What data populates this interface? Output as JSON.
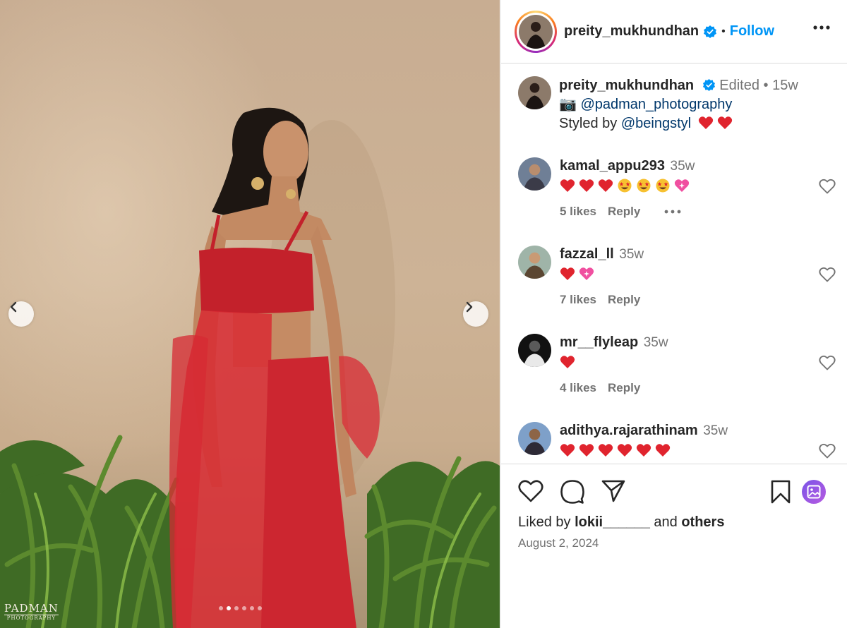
{
  "photo": {
    "watermark_top": "PADMAN",
    "watermark_sub": "PHOTOGRAPHY",
    "carousel_total": 6,
    "carousel_active_index": 1
  },
  "post_header": {
    "username": "preity_mukhundhan",
    "separator": "•",
    "follow_label": "Follow"
  },
  "caption": {
    "username": "preity_mukhundhan",
    "edited": "Edited",
    "separator": "•",
    "time": "15w",
    "camera_emoji": "📷",
    "photo_credit": "@padman_photography",
    "styled_prefix": "Styled by",
    "stylist": "@beingstyl",
    "hearts": "❤️ ❤️"
  },
  "comments": [
    {
      "username": "kamal_appu293",
      "time": "35w",
      "emojis": [
        "heart",
        "heart",
        "heart",
        "star-eyes",
        "star-eyes",
        "star-eyes",
        "sparkle-heart"
      ],
      "likes": "5 likes",
      "reply": "Reply",
      "has_more": true
    },
    {
      "username": "fazzal_ll",
      "time": "35w",
      "emojis": [
        "heart",
        "sparkle-heart"
      ],
      "likes": "7 likes",
      "reply": "Reply",
      "has_more": false
    },
    {
      "username": "mr__flyleap",
      "time": "35w",
      "emojis": [
        "heart"
      ],
      "likes": "4 likes",
      "reply": "Reply",
      "has_more": false
    },
    {
      "username": "adithya.rajarathinam",
      "time": "35w",
      "emojis": [
        "heart",
        "heart",
        "heart",
        "heart",
        "heart",
        "heart"
      ],
      "likes": "",
      "reply": "",
      "has_more": false
    }
  ],
  "footer": {
    "liked_prefix": "Liked by",
    "liked_user": "lokii______",
    "liked_mid": "and",
    "liked_others": "others",
    "date": "August 2, 2024"
  },
  "colors": {
    "accent": "#0095f6",
    "verified": "#0095f6",
    "muted": "#737373",
    "heart": "#e0242e",
    "border": "#dbdbdb"
  },
  "icons": [
    "chevron-left-icon",
    "chevron-right-icon",
    "more-icon",
    "verified-icon",
    "heart-icon",
    "comment-icon",
    "share-icon",
    "bookmark-icon",
    "gallery-icon"
  ]
}
